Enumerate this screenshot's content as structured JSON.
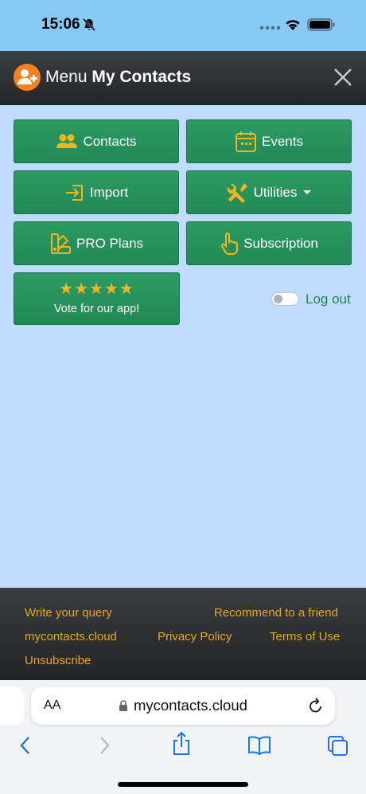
{
  "status_bar": {
    "time": "15:06"
  },
  "header": {
    "menu_label": "Menu",
    "app_name": "My Contacts"
  },
  "menu": {
    "contacts": "Contacts",
    "events": "Events",
    "import": "Import",
    "utilities": "Utilities",
    "pro_plans": "PRO Plans",
    "subscription": "Subscription",
    "vote_stars": "★★★★★",
    "vote": "Vote for our app!"
  },
  "logout": {
    "label": "Log out",
    "enabled": false
  },
  "footer": {
    "write_query": "Write your query",
    "recommend": "Recommend to a friend",
    "site": "mycontacts.cloud",
    "privacy": "Privacy Policy",
    "terms": "Terms of Use",
    "unsubscribe": "Unsubscribe"
  },
  "browser": {
    "aa": "AA",
    "url": "mycontacts.cloud"
  },
  "colors": {
    "accent_orange": "#f6b51f",
    "button_green": "#2c9a63",
    "link_gold": "#e6a823",
    "page_bg": "#bfdcff"
  }
}
